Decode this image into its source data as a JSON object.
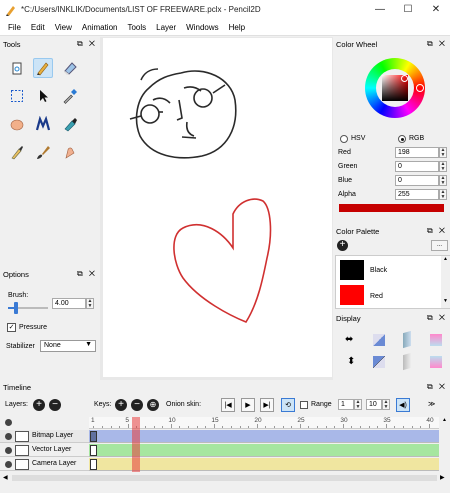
{
  "window": {
    "title": "*C:/Users/INKLIK/Documents/LIST OF FREEWARE.pclx - Pencil2D",
    "minimize_icon": "minimize-icon",
    "maximize_icon": "maximize-icon",
    "close_icon": "close-icon"
  },
  "menu": [
    "File",
    "Edit",
    "View",
    "Animation",
    "Tools",
    "Layer",
    "Windows",
    "Help"
  ],
  "tools_panel": {
    "title": "Tools",
    "tools": [
      "clear-icon",
      "pencil-icon",
      "eraser-icon",
      "select-icon",
      "move-icon",
      "eyedropper-icon",
      "hand-icon",
      "polyline-icon",
      "bucket-icon",
      "pen-icon",
      "brush-icon",
      "smudge-icon"
    ],
    "selected": "pencil-icon"
  },
  "options_panel": {
    "title": "Options",
    "brush_label": "Brush:",
    "brush_value": "4.00",
    "brush_level": 0.2,
    "pressure_label": "Pressure",
    "pressure_checked": true,
    "stabilizer_label": "Stabilizer",
    "stabilizer_value": "None"
  },
  "color_wheel": {
    "title": "Color Wheel",
    "hsv_label": "HSV",
    "rgb_label": "RGB",
    "mode": "RGB",
    "red_label": "Red",
    "red_value": "198",
    "green_label": "Green",
    "green_value": "0",
    "blue_label": "Blue",
    "blue_value": "0",
    "alpha_label": "Alpha",
    "alpha_value": "255",
    "current_color": "#c60000"
  },
  "color_palette": {
    "title": "Color Palette",
    "add_icon": "add-icon",
    "menu_label": "...",
    "items": [
      {
        "name": "Black",
        "color": "#000000"
      },
      {
        "name": "Red",
        "color": "#ff0000"
      }
    ]
  },
  "display_panel": {
    "title": "Display",
    "icons": [
      "horizontal-flip-icon",
      "onion-prev-icon",
      "onion-blue-icon",
      "onion-red-icon",
      "vertical-flip-icon",
      "outline-icon",
      "onion-next-blue-icon",
      "onion-next-red-icon"
    ]
  },
  "timeline": {
    "title": "Timeline",
    "layers_label": "Layers:",
    "keys_label": "Keys:",
    "onion_label": "Onion skin:",
    "range_label": "Range",
    "range_start": "1",
    "range_end": "10",
    "frame_ticks": [
      "1",
      "5",
      "10",
      "15",
      "20",
      "25",
      "30",
      "35",
      "40"
    ],
    "current_frame": 6,
    "layers": [
      {
        "name": "Bitmap Layer",
        "icon": "bitmap-layer-icon",
        "color": "#a9b8e8"
      },
      {
        "name": "Vector Layer",
        "icon": "vector-layer-icon",
        "color": "#a6e6a0"
      },
      {
        "name": "Camera Layer",
        "icon": "camera-layer-icon",
        "color": "#f0e6a0"
      }
    ]
  }
}
